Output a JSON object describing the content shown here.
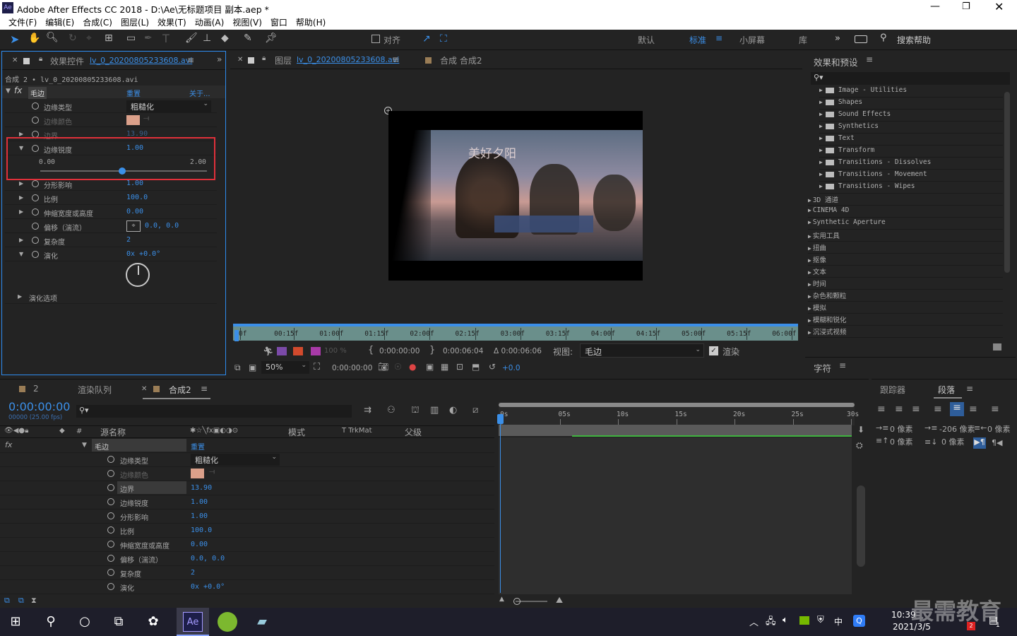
{
  "window": {
    "title": "Adobe After Effects CC 2018 - D:\\Ae\\无标题项目 副本.aep *",
    "app_icon": "Ae"
  },
  "menu": [
    "文件(F)",
    "编辑(E)",
    "合成(C)",
    "图层(L)",
    "效果(T)",
    "动画(A)",
    "视图(V)",
    "窗口",
    "帮助(H)"
  ],
  "toolbar": {
    "snap_label": "对齐",
    "workspaces": [
      "默认",
      "标准",
      "小屏幕",
      "库"
    ],
    "active_workspace": "标准",
    "search_placeholder": "搜索帮助"
  },
  "effect_controls": {
    "tab_title": "效果控件",
    "tab_file": "lv_0_20200805233608.avi",
    "subtitle": "合成 2 • lv_0_20200805233608.avi",
    "fx_label": "fx",
    "effect_name": "毛边",
    "reset": "重置",
    "about": "关于...",
    "props": [
      {
        "name": "边缘类型",
        "value": "粗糙化",
        "kind": "dropdown"
      },
      {
        "name": "边缘颜色",
        "value": "",
        "kind": "color",
        "dim": true
      },
      {
        "name": "边界",
        "value": "13.90",
        "kind": "num",
        "dim": true
      },
      {
        "name": "边缘锐度",
        "value": "1.00",
        "kind": "num",
        "expanded": true
      },
      {
        "name": "分形影响",
        "value": "1.00",
        "kind": "num"
      },
      {
        "name": "比例",
        "value": "100.0",
        "kind": "num"
      },
      {
        "name": "伸缩宽度或高度",
        "value": "0.00",
        "kind": "num"
      },
      {
        "name": "偏移（湍流）",
        "value": "0.0, 0.0",
        "kind": "point"
      },
      {
        "name": "复杂度",
        "value": "2",
        "kind": "num"
      },
      {
        "name": "演化",
        "value": "0x +0.0°",
        "kind": "angle"
      },
      {
        "name": "演化选项",
        "value": "",
        "kind": "group"
      }
    ],
    "slider": {
      "min": "0.00",
      "max": "2.00",
      "value": 0.5
    }
  },
  "viewer": {
    "layer_tab": "图层",
    "layer_file": "lv_0_20200805233608.avi",
    "comp_tab": "合成 合成2",
    "overlay_text": "美好夕阳",
    "ruler": [
      "0f",
      "00:15f",
      "01:00f",
      "01:15f",
      "02:00f",
      "02:15f",
      "03:00f",
      "03:15f",
      "04:00f",
      "04:15f",
      "05:00f",
      "05:15f",
      "06:00f"
    ],
    "opacity": "100 %",
    "in_time": "0:00:00:00",
    "out_time": "0:00:06:04",
    "duration": "Δ 0:00:06:06",
    "view_label": "视图:",
    "view_value": "毛边",
    "render_label": "渲染",
    "zoom": "50%",
    "current_time": "0:00:00:00",
    "exposure": "+0.0"
  },
  "effects_presets": {
    "title": "效果和预设",
    "items": [
      {
        "label": "Image - Utilities",
        "level": 1,
        "folder": true
      },
      {
        "label": "Shapes",
        "level": 1,
        "folder": true
      },
      {
        "label": "Sound Effects",
        "level": 1,
        "folder": true
      },
      {
        "label": "Synthetics",
        "level": 1,
        "folder": true
      },
      {
        "label": "Text",
        "level": 1,
        "folder": true
      },
      {
        "label": "Transform",
        "level": 1,
        "folder": true
      },
      {
        "label": "Transitions - Dissolves",
        "level": 1,
        "folder": true
      },
      {
        "label": "Transitions - Movement",
        "level": 1,
        "folder": true
      },
      {
        "label": "Transitions - Wipes",
        "level": 1,
        "folder": true
      },
      {
        "label": "3D 通道",
        "level": 0
      },
      {
        "label": "CINEMA 4D",
        "level": 0
      },
      {
        "label": "Synthetic Aperture",
        "level": 0
      },
      {
        "label": "实用工具",
        "level": 0
      },
      {
        "label": "扭曲",
        "level": 0
      },
      {
        "label": "抠像",
        "level": 0
      },
      {
        "label": "文本",
        "level": 0
      },
      {
        "label": "时间",
        "level": 0
      },
      {
        "label": "杂色和颗粒",
        "level": 0
      },
      {
        "label": "模拟",
        "level": 0
      },
      {
        "label": "模糊和锐化",
        "level": 0
      },
      {
        "label": "沉浸式视频",
        "level": 0
      }
    ],
    "char_title": "字符"
  },
  "paragraph": {
    "tabs": [
      "跟踪器",
      "段落"
    ],
    "active": "段落",
    "fields": [
      {
        "v": "0 像素"
      },
      {
        "v": "-206 像素"
      },
      {
        "v": "0 像素"
      },
      {
        "v": "0 像素"
      },
      {
        "v": "0 像素"
      }
    ]
  },
  "timeline": {
    "tabs": [
      {
        "num": "2"
      },
      {
        "label": "渲染队列"
      },
      {
        "label": "合成2",
        "active": true
      }
    ],
    "timecode": "0:00:00:00",
    "fps": "00000 (25.00 fps)",
    "columns": {
      "source": "源名称",
      "mode": "模式",
      "trk": "T  TrkMat",
      "parent": "父级"
    },
    "ticks": [
      "0s",
      "05s",
      "10s",
      "15s",
      "20s",
      "25s",
      "30s"
    ],
    "rows": [
      {
        "name": "毛边",
        "value": "重置",
        "kind": "header"
      },
      {
        "name": "边缘类型",
        "value": "粗糙化",
        "kind": "dropdown"
      },
      {
        "name": "边缘颜色",
        "value": "",
        "kind": "color",
        "dim": true
      },
      {
        "name": "边界",
        "value": "13.90",
        "kind": "num",
        "sel": true
      },
      {
        "name": "边缘锐度",
        "value": "1.00",
        "kind": "num"
      },
      {
        "name": "分形影响",
        "value": "1.00",
        "kind": "num"
      },
      {
        "name": "比例",
        "value": "100.0",
        "kind": "num"
      },
      {
        "name": "伸缩宽度或高度",
        "value": "0.00",
        "kind": "num"
      },
      {
        "name": "偏移（湍流）",
        "value": "0.0, 0.0",
        "kind": "num"
      },
      {
        "name": "复杂度",
        "value": "2",
        "kind": "num"
      },
      {
        "name": "演化",
        "value": "0x +0.0°",
        "kind": "num"
      }
    ]
  },
  "taskbar": {
    "time": "10:39",
    "date": "2021/3/5",
    "ime": "中",
    "notif": "1",
    "badge": "2",
    "watermark": "最需教育"
  }
}
